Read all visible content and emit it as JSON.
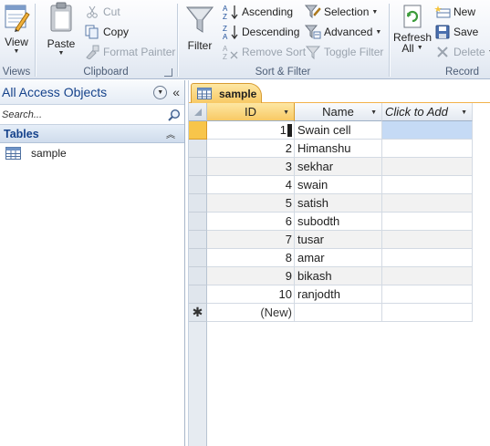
{
  "ribbon": {
    "views": {
      "view_label": "View",
      "group_label": "Views"
    },
    "clipboard": {
      "paste_label": "Paste",
      "cut_label": "Cut",
      "copy_label": "Copy",
      "format_painter_label": "Format Painter",
      "group_label": "Clipboard"
    },
    "sort_filter": {
      "filter_label": "Filter",
      "ascending_label": "Ascending",
      "descending_label": "Descending",
      "remove_sort_label": "Remove Sort",
      "selection_label": "Selection",
      "advanced_label": "Advanced",
      "toggle_filter_label": "Toggle Filter",
      "group_label": "Sort & Filter"
    },
    "records": {
      "refresh_label": "Refresh",
      "refresh_sub_label": "All",
      "new_label": "New",
      "save_label": "Save",
      "delete_label": "Delete",
      "group_label": "Record"
    }
  },
  "nav": {
    "title": "All Access Objects",
    "search_placeholder": "Search...",
    "section_title": "Tables",
    "items": [
      {
        "label": "sample",
        "icon": "table-icon"
      }
    ]
  },
  "document": {
    "tab_label": "sample",
    "columns": [
      "ID",
      "Name",
      "Click to Add"
    ],
    "rows": [
      {
        "id": "1",
        "name": "Swain cell"
      },
      {
        "id": "2",
        "name": "Himanshu"
      },
      {
        "id": "3",
        "name": "sekhar"
      },
      {
        "id": "4",
        "name": "swain"
      },
      {
        "id": "5",
        "name": "satish"
      },
      {
        "id": "6",
        "name": "subodth"
      },
      {
        "id": "7",
        "name": "tusar"
      },
      {
        "id": "8",
        "name": "amar"
      },
      {
        "id": "9",
        "name": "bikash"
      },
      {
        "id": "10",
        "name": "ranjodth"
      }
    ],
    "new_row_label": "(New)",
    "new_row_marker": "✱"
  },
  "colors": {
    "accent": "#f8c964",
    "nav_title": "#15428b",
    "current_row_selector": "#f8c54a",
    "selection_highlight": "#c5daf5"
  }
}
